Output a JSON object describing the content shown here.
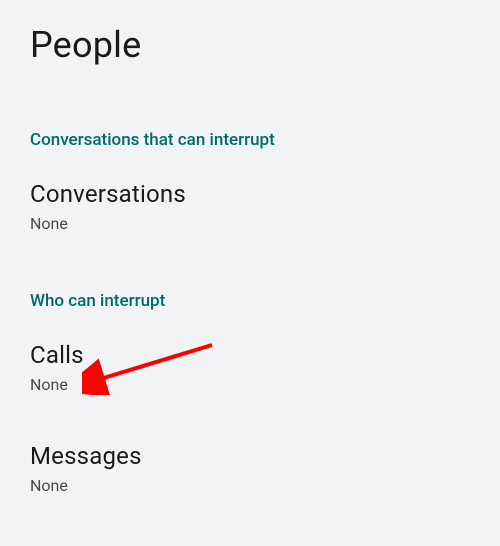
{
  "header": {
    "title": "People"
  },
  "sections": {
    "conversations": {
      "header": "Conversations that can interrupt",
      "items": {
        "conversations": {
          "title": "Conversations",
          "value": "None"
        }
      }
    },
    "who": {
      "header": "Who can interrupt",
      "items": {
        "calls": {
          "title": "Calls",
          "value": "None"
        },
        "messages": {
          "title": "Messages",
          "value": "None"
        }
      }
    }
  },
  "annotation": {
    "arrow_color": "#ff0000",
    "points_to": "calls"
  }
}
